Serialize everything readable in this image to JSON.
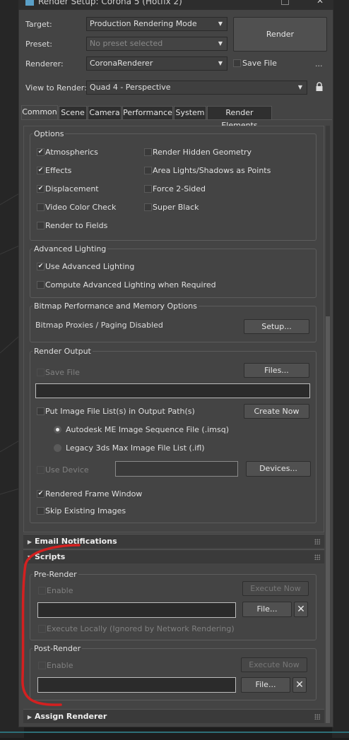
{
  "window": {
    "title": "Render Setup: Corona 5 (Hotfix 2)"
  },
  "header": {
    "target_label": "Target:",
    "target_value": "Production Rendering Mode",
    "preset_label": "Preset:",
    "preset_value": "No preset selected",
    "renderer_label": "Renderer:",
    "renderer_value": "CoronaRenderer",
    "view_label": "View to Render:",
    "view_value": "Quad 4 - Perspective",
    "render_button": "Render",
    "save_file": "Save File",
    "more": "..."
  },
  "tabs": [
    "Common",
    "Scene",
    "Camera",
    "Performance",
    "System",
    "Render Elements"
  ],
  "options": {
    "title": "Options",
    "atmospherics": "Atmospherics",
    "effects": "Effects",
    "displacement": "Displacement",
    "video_color_check": "Video Color Check",
    "render_to_fields": "Render to Fields",
    "render_hidden": "Render Hidden Geometry",
    "area_lights": "Area Lights/Shadows as Points",
    "force_2sided": "Force 2-Sided",
    "super_black": "Super Black"
  },
  "advanced_lighting": {
    "title": "Advanced Lighting",
    "use": "Use Advanced Lighting",
    "compute": "Compute Advanced Lighting when Required"
  },
  "bitmap": {
    "title": "Bitmap Performance and Memory Options",
    "status": "Bitmap Proxies / Paging Disabled",
    "setup_button": "Setup..."
  },
  "render_output": {
    "title": "Render Output",
    "save_file": "Save File",
    "files_button": "Files...",
    "put_image": "Put Image File List(s) in Output Path(s)",
    "create_now": "Create Now",
    "radio_imsq": "Autodesk ME Image Sequence File (.imsq)",
    "radio_ifl": "Legacy 3ds Max Image File List (.ifl)",
    "use_device": "Use Device",
    "devices_button": "Devices...",
    "rendered_frame": "Rendered Frame Window",
    "skip_existing": "Skip Existing Images"
  },
  "rollouts": {
    "email": "Email Notifications",
    "scripts": "Scripts",
    "assign": "Assign Renderer"
  },
  "scripts": {
    "pre_title": "Pre-Render",
    "pre_enable": "Enable",
    "pre_execute": "Execute Now",
    "pre_file": "File...",
    "execute_locally": "Execute Locally (Ignored by Network Rendering)",
    "post_title": "Post-Render",
    "post_enable": "Enable",
    "post_execute": "Execute Now",
    "post_file": "File...",
    "delete_icon_glyph": "✕"
  },
  "colors": {
    "annotation": "#d42020",
    "accent": "#e6e6e6"
  }
}
